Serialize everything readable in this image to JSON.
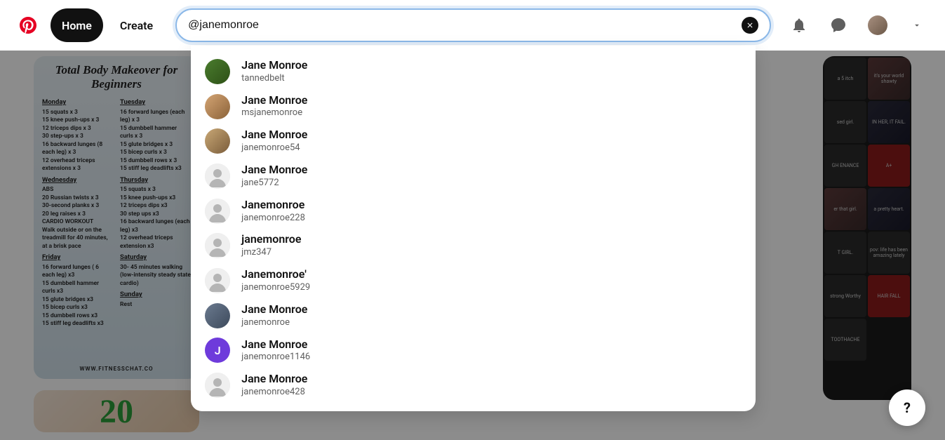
{
  "nav": {
    "home": "Home",
    "create": "Create"
  },
  "search": {
    "value": "@janemonroe"
  },
  "suggestions": [
    {
      "name": "Jane Monroe",
      "username": "tannedbelt",
      "avatar": "img-green"
    },
    {
      "name": "Jane Monroe",
      "username": "msjanemonroe",
      "avatar": "img-woman1"
    },
    {
      "name": "Jane Monroe",
      "username": "janemonroe54",
      "avatar": "img-couple"
    },
    {
      "name": "Jane Monroe",
      "username": "jane5772",
      "avatar": "default"
    },
    {
      "name": "Janemonroe",
      "username": "janemonroe228",
      "avatar": "default"
    },
    {
      "name": "janemonroe",
      "username": "jmz347",
      "avatar": "default"
    },
    {
      "name": "Janemonroe'",
      "username": "janemonroe5929",
      "avatar": "default"
    },
    {
      "name": "Jane Monroe",
      "username": "janemonroe",
      "avatar": "img-two"
    },
    {
      "name": "Jane Monroe",
      "username": "janemonroe1146",
      "avatar": "letter-J"
    },
    {
      "name": "Jane Monroe",
      "username": "janemonroe428",
      "avatar": "default"
    }
  ],
  "help": "?",
  "workout_pin": {
    "title": "Total Body Makeover for Beginners",
    "footer": "WWW.FITNESSCHAT.CO",
    "days": {
      "monday": {
        "label": "Monday",
        "lines": [
          "15 squats x 3",
          "15 knee push-ups x 3",
          "12 triceps dips x 3",
          "30 step-ups x 3",
          "16 backward lunges (8 each leg) x 3",
          "12 overhead triceps extensions x 3"
        ]
      },
      "wednesday": {
        "label": "Wednesday",
        "lines": [
          "ABS",
          "20 Russian twists x 3",
          "30-second planks x 3",
          "20 leg raises  x 3",
          "",
          "CARDIO WORKOUT",
          "Walk outside or on the treadmill for 40 minutes, at a brisk pace"
        ]
      },
      "friday": {
        "label": "Friday",
        "lines": [
          "16 forward lunges ( 6 each leg) x3",
          "15 dumbbell hammer curls x3",
          "15 glute bridges x3",
          "15 bicep curls x3",
          "15 dumbbell rows x3",
          "15 stiff leg deadlifts x3"
        ]
      },
      "tuesday": {
        "label": "Tuesday",
        "lines": [
          "16 forward lunges (each leg) x 3",
          "15 dumbbell hammer curls x 3",
          "15 glute bridges x 3",
          "15 bicep curls x 3",
          "15 dumbbell rows x 3",
          "15 stiff leg deadlifts x3"
        ]
      },
      "thursday": {
        "label": "Thursday",
        "lines": [
          "15 squats x 3",
          "15  knee push-ups x3",
          "12 triceps dips x3",
          "30 step ups x3",
          "16 backward lunges (each leg) x3",
          "12 overhead triceps extension x3"
        ]
      },
      "saturday": {
        "label": "Saturday",
        "lines": [
          "30- 45 minutes walking (low-intensity steady state cardio)"
        ]
      },
      "sunday": {
        "label": "Sunday",
        "lines": [
          "Rest"
        ]
      }
    }
  },
  "twenty_pin": "20",
  "collage_texts": [
    "a 5 itch",
    "it's your world shawty",
    "sed girl.",
    "IN HER, IT FAIL.",
    "GH ENANCE",
    "A+",
    "er that girl.",
    "a pretty heart.",
    "T GIRL.",
    "pov: life has been amazing lately",
    "strong Worthy",
    "HAIR FALL",
    "TOOTHACHE"
  ]
}
